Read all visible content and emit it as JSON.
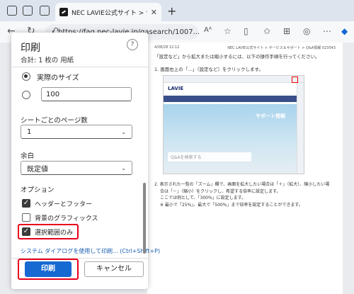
{
  "browser": {
    "tab_title": "NEC LAVIE公式サイト > サービス＆サ",
    "tab_close": "✕",
    "new_tab": "+",
    "url": "https://faq.nec-lavie.jp/qasearch/1007...",
    "reader_label": "Aᴬ"
  },
  "dialog": {
    "title": "印刷",
    "subtitle": "合計: 1 枚の 用紙",
    "help": "?",
    "scale": {
      "actual_size_label": "実際のサイズ",
      "custom_value": "100"
    },
    "pages_per_sheet": {
      "label": "シートごとのページ数",
      "value": "1"
    },
    "margins": {
      "label": "余白",
      "value": "既定値"
    },
    "options": {
      "label": "オプション",
      "header_footer": "ヘッダーとフッター",
      "background_graphics": "背景のグラフィックス",
      "selection_only": "選択範囲のみ"
    },
    "system_dialog_link": "システム ダイアログを使用して印刷... (Ctrl+Shift+P)",
    "print_button": "印刷",
    "cancel_button": "キャンセル"
  },
  "preview": {
    "header_left": "4/08/28 12:12",
    "header_right": "NEC LAVIE公式サイト > サービス＆サポート > Q&A情報 023543",
    "intro": "「設定など」から拡大または縮小するには、以下の操作手順を行ってください。",
    "step1": "1. 画面右上の「…」（設定など）をクリックします。",
    "shot_logo": "LAVIE",
    "shot_hero_label": "サポート情報",
    "shot_search": "Q&Aを検索する",
    "step2_line1": "2. 表示された一覧の「ズーム」欄で、画面を拡大したい場合は「＋」（拡大）、縮小したい場",
    "step2_line2": "合は「－」（縮小）をクリックし、希望する倍率に設定します。",
    "step2_line3": "ここでは例として、「300%」に設定します。",
    "step2_line4": "※ 最小で「25%」、最大で「500%」まで倍率を設定することができます。"
  },
  "accent_colors": {
    "primary": "#1769d2",
    "highlight": "#e8001c"
  }
}
